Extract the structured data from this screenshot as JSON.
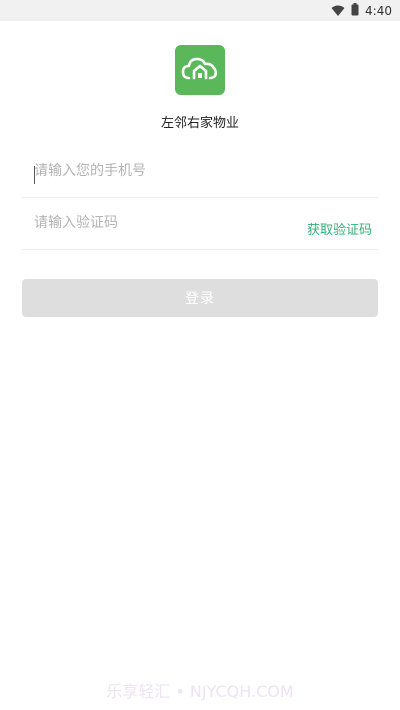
{
  "status_bar": {
    "time": "4:40",
    "icons": [
      "wifi-icon",
      "battery-icon"
    ]
  },
  "app": {
    "name": "左邻右家物业",
    "logo_icon": "cloud-home-icon",
    "brand_color": "#5ab85a"
  },
  "form": {
    "phone_placeholder": "请输入您的手机号",
    "code_placeholder": "请输入验证码",
    "get_code_label": "获取验证码",
    "login_label": "登录",
    "accent_color": "#2fb27a"
  },
  "watermark": {
    "text": "乐享轻汇 • NJYCQH.COM"
  }
}
